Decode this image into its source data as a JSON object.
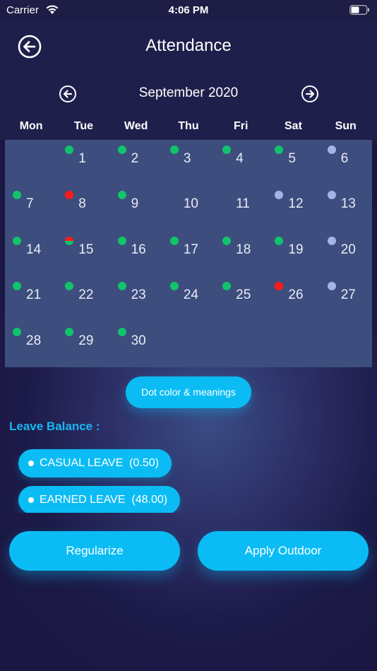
{
  "status_bar": {
    "carrier": "Carrier",
    "time": "4:06 PM"
  },
  "header": {
    "title": "Attendance",
    "back_icon": "arrow-left-circle-icon"
  },
  "month_nav": {
    "label": "September 2020",
    "prev_icon": "arrow-left-circle-icon",
    "next_icon": "arrow-right-circle-icon"
  },
  "weekdays": [
    "Mon",
    "Tue",
    "Wed",
    "Thu",
    "Fri",
    "Sat",
    "Sun"
  ],
  "calendar": {
    "start_offset": 1,
    "days": [
      {
        "day": "1",
        "status": "present"
      },
      {
        "day": "2",
        "status": "present"
      },
      {
        "day": "3",
        "status": "present"
      },
      {
        "day": "4",
        "status": "present"
      },
      {
        "day": "5",
        "status": "present"
      },
      {
        "day": "6",
        "status": "weekoff"
      },
      {
        "day": "7",
        "status": "present"
      },
      {
        "day": "8",
        "status": "absent"
      },
      {
        "day": "9",
        "status": "present"
      },
      {
        "day": "10",
        "status": "none"
      },
      {
        "day": "11",
        "status": "none"
      },
      {
        "day": "12",
        "status": "weekoff"
      },
      {
        "day": "13",
        "status": "weekoff"
      },
      {
        "day": "14",
        "status": "present"
      },
      {
        "day": "15",
        "status": "half"
      },
      {
        "day": "16",
        "status": "present"
      },
      {
        "day": "17",
        "status": "present"
      },
      {
        "day": "18",
        "status": "present"
      },
      {
        "day": "19",
        "status": "present"
      },
      {
        "day": "20",
        "status": "weekoff"
      },
      {
        "day": "21",
        "status": "present"
      },
      {
        "day": "22",
        "status": "present"
      },
      {
        "day": "23",
        "status": "present"
      },
      {
        "day": "24",
        "status": "present"
      },
      {
        "day": "25",
        "status": "present"
      },
      {
        "day": "26",
        "status": "absent"
      },
      {
        "day": "27",
        "status": "weekoff"
      },
      {
        "day": "28",
        "status": "present"
      },
      {
        "day": "29",
        "status": "present"
      },
      {
        "day": "30",
        "status": "present"
      }
    ]
  },
  "colors": {
    "present": "#10c46a",
    "absent": "#ff1a1a",
    "weekoff": "#a5b3e6",
    "accent": "#0bbcf4"
  },
  "legend_button": {
    "label": "Dot color & meanings"
  },
  "leave_balance": {
    "title": "Leave Balance :",
    "items": [
      {
        "label": "CASUAL LEAVE  (0.50)"
      },
      {
        "label": "EARNED LEAVE  (48.00)"
      }
    ]
  },
  "actions": {
    "regularize": "Regularize",
    "apply_outdoor": "Apply Outdoor"
  }
}
